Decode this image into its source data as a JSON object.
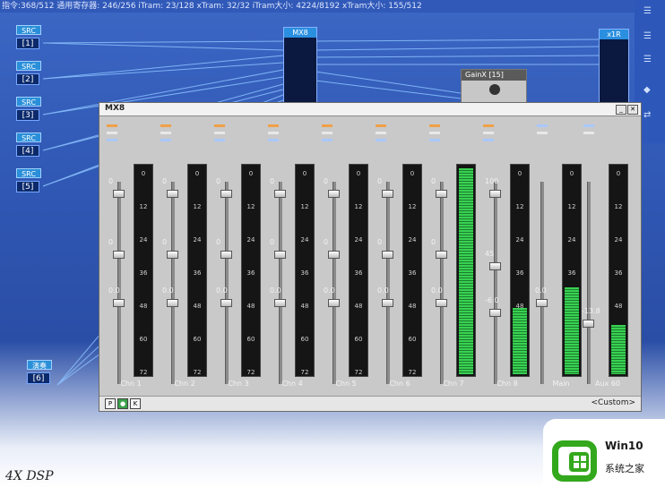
{
  "status_bar": {
    "text": "指令:368/512  通用寄存器: 246/256  iTram: 23/128  xTram: 32/32  iTram大小: 4224/8192  xTram大小: 155/512"
  },
  "src_boxes": [
    {
      "label": "SRC",
      "port": "[1]"
    },
    {
      "label": "SRC",
      "port": "[2]"
    },
    {
      "label": "SRC",
      "port": "[3]"
    },
    {
      "label": "SRC",
      "port": "[4]"
    },
    {
      "label": "SRC",
      "port": "[5]"
    },
    {
      "label": "演奏",
      "port": "[6]"
    }
  ],
  "blocks": {
    "mx8": "MX8",
    "x1r": "x1R",
    "gainx": "GainX [15]"
  },
  "mixer_window": {
    "title": "MX8",
    "bottom_buttons": [
      "P",
      "●",
      "K"
    ],
    "preset": "<Custom>"
  },
  "meter_ticks": [
    "0",
    "12",
    "24",
    "36",
    "48",
    "60",
    "72"
  ],
  "channels": [
    {
      "name": "Chn 1",
      "values": [
        "0",
        "0",
        "0.0"
      ],
      "levels": [
        0.04,
        0.34,
        0.58
      ],
      "meter": 0.0
    },
    {
      "name": "Chn 2",
      "values": [
        "0",
        "0",
        "0.0"
      ],
      "levels": [
        0.04,
        0.34,
        0.58
      ],
      "meter": 0.0
    },
    {
      "name": "Chn 3",
      "values": [
        "0",
        "0",
        "0.0"
      ],
      "levels": [
        0.04,
        0.34,
        0.58
      ],
      "meter": 0.0
    },
    {
      "name": "Chn 4",
      "values": [
        "0",
        "0",
        "0.0"
      ],
      "levels": [
        0.04,
        0.34,
        0.58
      ],
      "meter": 0.0
    },
    {
      "name": "Chn 5",
      "values": [
        "0",
        "0",
        "0.0"
      ],
      "levels": [
        0.04,
        0.34,
        0.58
      ],
      "meter": 0.0
    },
    {
      "name": "Chn 6",
      "values": [
        "0",
        "0",
        "0.0"
      ],
      "levels": [
        0.04,
        0.34,
        0.58
      ],
      "meter": 0.0
    },
    {
      "name": "Chn 7",
      "values": [
        "0",
        "0",
        "0.0"
      ],
      "levels": [
        0.04,
        0.34,
        0.58
      ],
      "meter": 1.0
    },
    {
      "name": "Chn 8",
      "values": [
        "100",
        "45",
        "-6.0"
      ],
      "levels": [
        0.04,
        0.4,
        0.63
      ],
      "meter": 0.32
    }
  ],
  "master": {
    "name": "Main",
    "value": "0.0",
    "level": 0.58,
    "meter": 0.42
  },
  "aux": {
    "name": "Aux 60",
    "value": "-13.8",
    "level": 0.68,
    "meter": 0.24
  },
  "watermark": {
    "name": "Win10",
    "sub": "系统之家"
  },
  "caption": "4X DSP"
}
